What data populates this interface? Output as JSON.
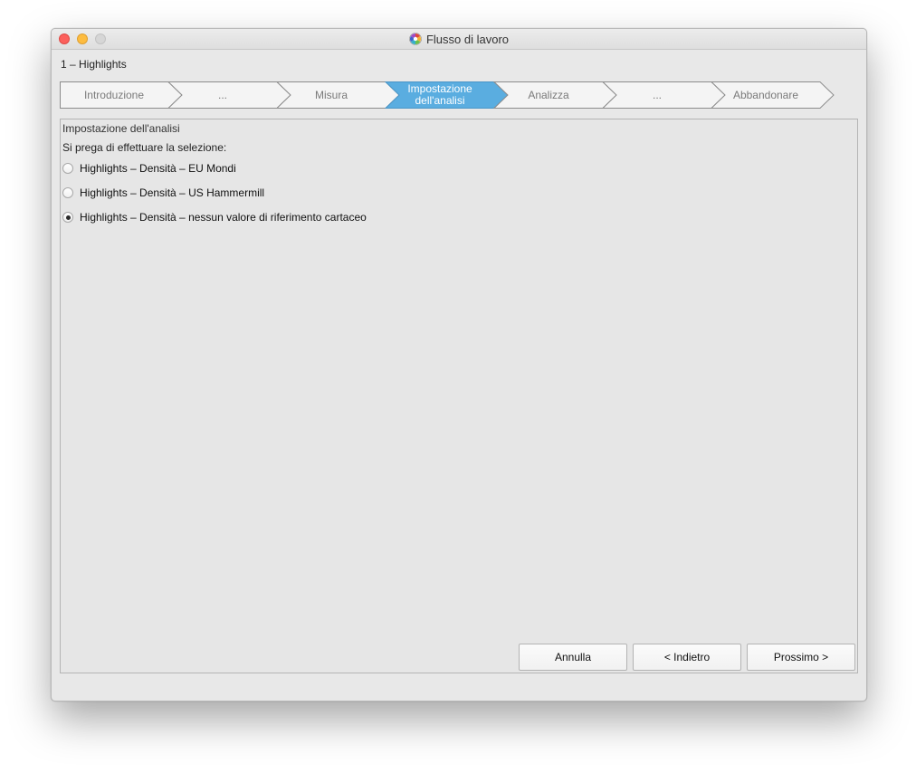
{
  "window": {
    "title": "Flusso di lavoro",
    "app_icon": "color-wheel-icon"
  },
  "breadcrumb": "1 – Highlights",
  "steps": [
    {
      "label": "Introduzione",
      "active": false
    },
    {
      "label": "...",
      "active": false
    },
    {
      "label": "Misura",
      "active": false
    },
    {
      "label": "Impostazione dell'analisi",
      "line1": "Impostazione",
      "line2": "dell'analisi",
      "active": true
    },
    {
      "label": "Analizza",
      "active": false
    },
    {
      "label": "...",
      "active": false
    },
    {
      "label": "Abbandonare",
      "active": false
    }
  ],
  "panel": {
    "title": "Impostazione dell'analisi",
    "instruction": "Si prega di effettuare la selezione:",
    "options": [
      {
        "label": "Highlights – Densità – EU Mondi",
        "checked": false
      },
      {
        "label": "Highlights – Densità – US Hammermill",
        "checked": false
      },
      {
        "label": "Highlights – Densità – nessun valore di riferimento cartaceo",
        "checked": true
      }
    ]
  },
  "buttons": {
    "cancel": "Annulla",
    "back": "<  Indietro",
    "next": "Prossimo  >"
  },
  "colors": {
    "active_step": "#5aade0",
    "inactive_step": "#f4f4f4",
    "window_bg": "#e8e8e8"
  }
}
